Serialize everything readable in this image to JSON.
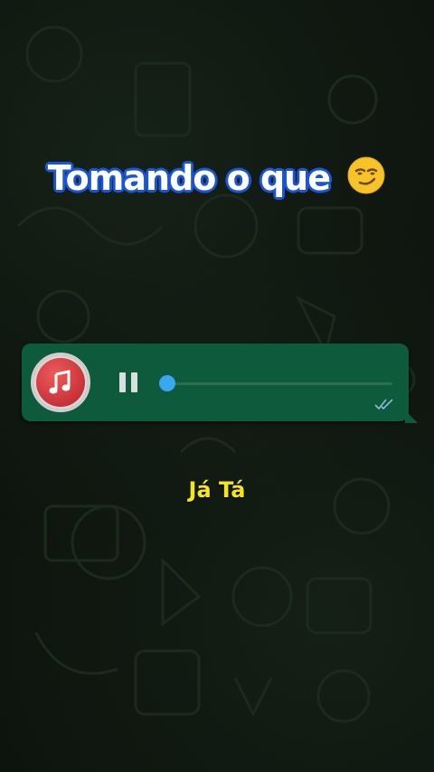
{
  "headline": {
    "text": "Tomando o que",
    "emoji": "smirking-face-emoji"
  },
  "voice_message": {
    "avatar_icon": "music-note-icon",
    "control_icon": "pause-icon",
    "progress": 0.0,
    "status_icon": "double-check-icon"
  },
  "caption": {
    "text": "Já Tá"
  },
  "colors": {
    "bubble": "#0e5a3c",
    "avatar": "#c32f35",
    "progress_knob": "#3aa7f0",
    "caption": "#f5e61c",
    "headline_outline": "#1b56d6"
  }
}
